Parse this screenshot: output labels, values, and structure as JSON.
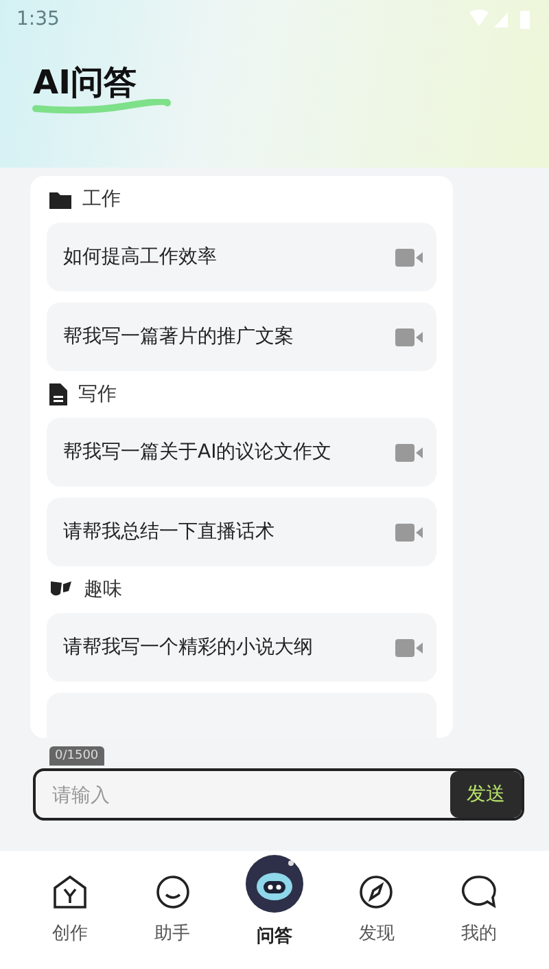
{
  "status_bar": {
    "time": "1:35"
  },
  "header": {
    "title": "AI问答"
  },
  "categories": [
    {
      "label": "工作",
      "items": [
        "如何提高工作效率",
        "帮我写一篇著片的推广文案"
      ]
    },
    {
      "label": "写作",
      "items": [
        "帮我写一篇关于AI的议论文作文",
        "请帮我总结一下直播话术"
      ]
    },
    {
      "label": "趣味",
      "items": [
        "请帮我写一个精彩的小说大纲"
      ]
    }
  ],
  "composer": {
    "counter": "0/1500",
    "placeholder": "请输入",
    "send": "发送"
  },
  "nav": [
    {
      "label": "创作",
      "selected": false
    },
    {
      "label": "助手",
      "selected": false
    },
    {
      "label": "问答",
      "selected": true
    },
    {
      "label": "发现",
      "selected": false
    },
    {
      "label": "我的",
      "selected": false
    }
  ]
}
